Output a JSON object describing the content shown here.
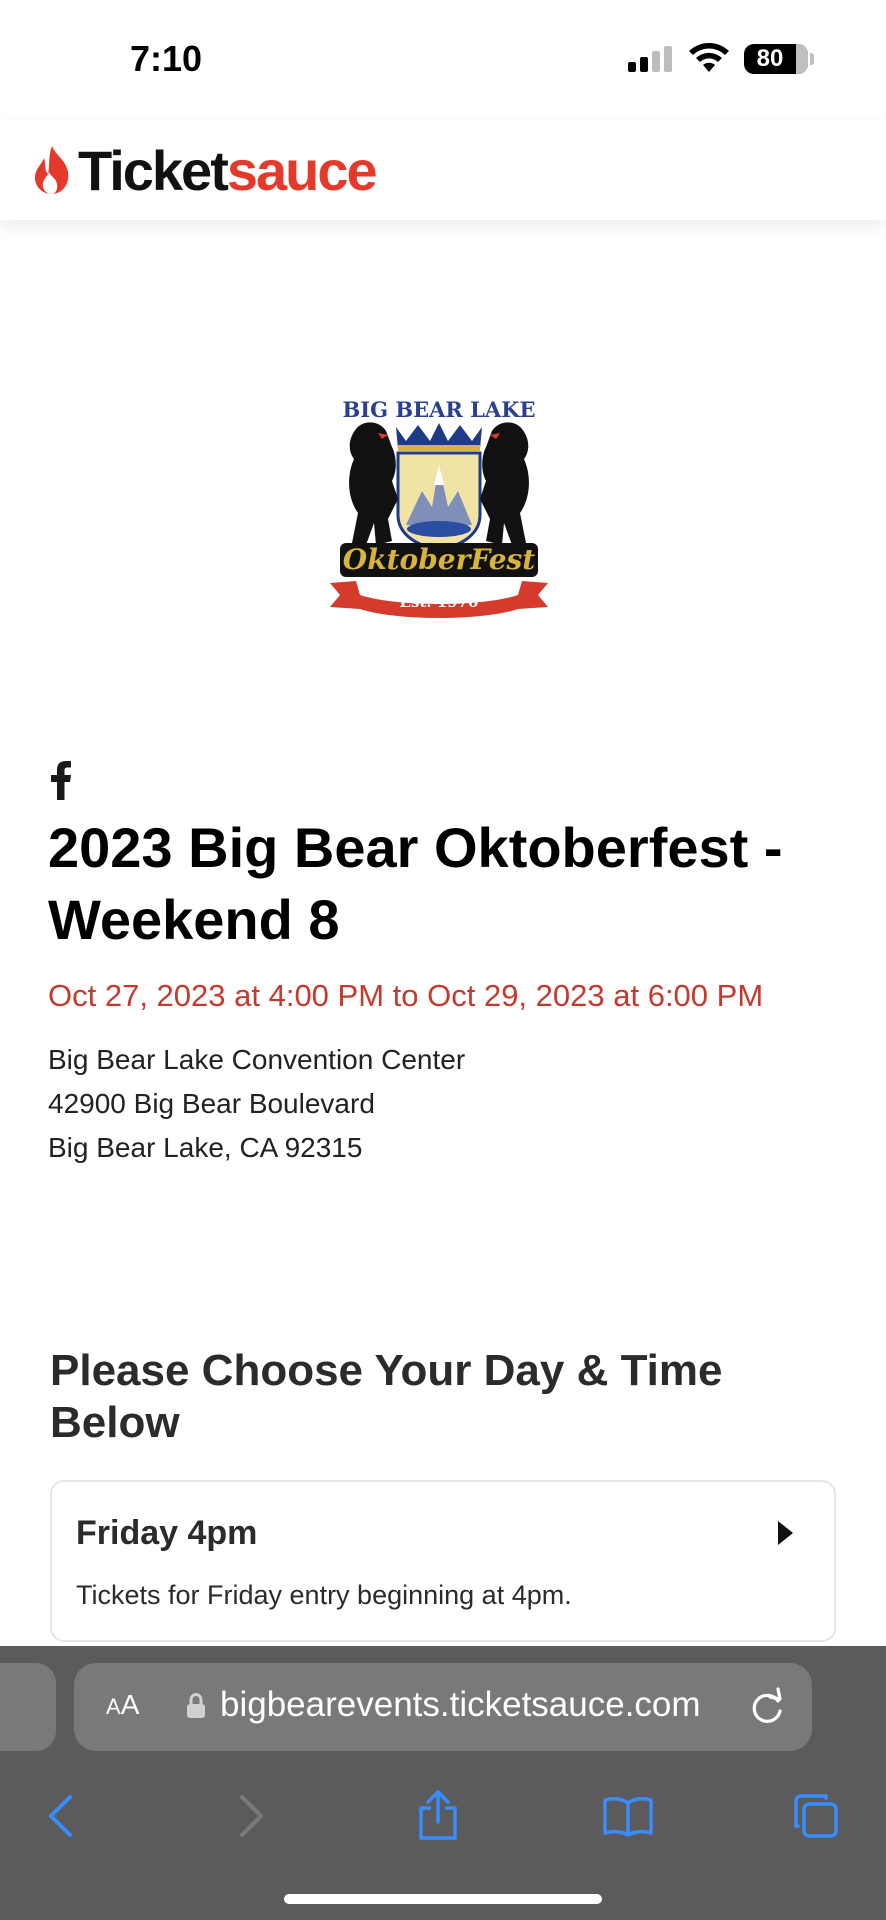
{
  "status_bar": {
    "time": "7:10",
    "battery": "80"
  },
  "header": {
    "logo_part1": "Ticket",
    "logo_part2": "sauce",
    "brand_color": "#e53a2b"
  },
  "event": {
    "logo_icon": "oktoberfest-logo",
    "social_icon": "facebook-icon",
    "title": "2023 Big Bear Oktoberfest - Weekend 8",
    "date_range": "Oct 27, 2023 at 4:00 PM to Oct 29, 2023 at 6:00 PM",
    "date_color": "#c53a2e",
    "venue": {
      "name": "Big Bear Lake Convention Center",
      "street": "42900 Big Bear Boulevard",
      "city": "Big Bear Lake, CA 92315"
    }
  },
  "tickets": {
    "heading": "Please Choose Your Day & Time Below",
    "options": [
      {
        "title": "Friday 4pm",
        "description": "Tickets for Friday entry beginning at 4pm."
      }
    ]
  },
  "browser": {
    "aa_label_small": "A",
    "aa_label_large": "A",
    "url": "bigbearevents.ticketsauce.com",
    "toolbar_icons": [
      "back-icon",
      "forward-icon",
      "share-icon",
      "bookmarks-icon",
      "tabs-icon"
    ],
    "accent_color": "#3a8dff"
  }
}
